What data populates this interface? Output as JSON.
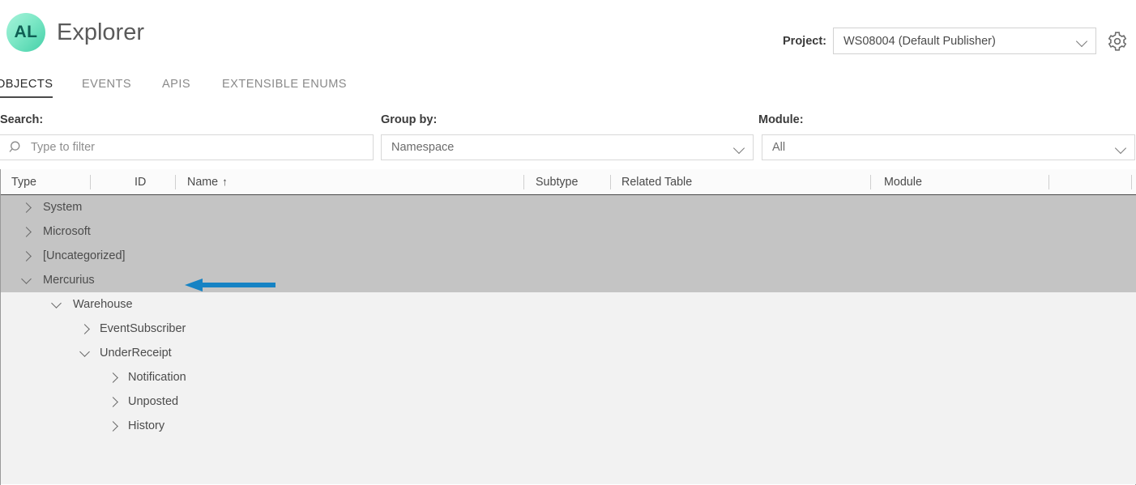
{
  "header": {
    "logo_text": "AL",
    "logo_icon": "al-circle-logo",
    "title": "Explorer",
    "project_label": "Project:",
    "project_value": "WS08004 (Default Publisher)",
    "settings_icon": "gear-icon",
    "chevron_icon": "chevron-down-icon"
  },
  "tabs": [
    {
      "label": "OBJECTS",
      "active": true
    },
    {
      "label": "EVENTS",
      "active": false
    },
    {
      "label": "APIS",
      "active": false
    },
    {
      "label": "EXTENSIBLE ENUMS",
      "active": false
    }
  ],
  "filters": {
    "search_label": "Search:",
    "search_value": "",
    "search_placeholder": "Type to filter",
    "search_icon": "search-icon",
    "group_label": "Group by:",
    "group_value": "Namespace",
    "module_label": "Module:",
    "module_value": "All"
  },
  "table": {
    "columns": [
      {
        "key": "type",
        "label": "Type"
      },
      {
        "key": "id",
        "label": "ID"
      },
      {
        "key": "name",
        "label": "Name"
      },
      {
        "key": "subtype",
        "label": "Subtype"
      },
      {
        "key": "related",
        "label": "Related Table"
      },
      {
        "key": "module",
        "label": "Module"
      },
      {
        "key": "bookmark",
        "label": "",
        "icon": "bookmark-icon"
      }
    ],
    "sort_column": "Name",
    "sort_arrow": "↑",
    "rows": [
      {
        "label": "System",
        "depth": 0,
        "expanded": false,
        "selected": true
      },
      {
        "label": "Microsoft",
        "depth": 0,
        "expanded": false,
        "selected": true
      },
      {
        "label": "[Uncategorized]",
        "depth": 0,
        "expanded": false,
        "selected": true
      },
      {
        "label": "Mercurius",
        "depth": 0,
        "expanded": true,
        "selected": true
      },
      {
        "label": "Warehouse",
        "depth": 1,
        "expanded": true,
        "selected": false
      },
      {
        "label": "EventSubscriber",
        "depth": 2,
        "expanded": false,
        "selected": false
      },
      {
        "label": "UnderReceipt",
        "depth": 2,
        "expanded": true,
        "selected": false
      },
      {
        "label": "Notification",
        "depth": 3,
        "expanded": false,
        "selected": false
      },
      {
        "label": "Unposted",
        "depth": 3,
        "expanded": false,
        "selected": false
      },
      {
        "label": "History",
        "depth": 3,
        "expanded": false,
        "selected": false
      }
    ]
  },
  "annotation": {
    "type": "left-pointing-arrow",
    "color": "#1683c4",
    "target_row": "Mercurius"
  }
}
